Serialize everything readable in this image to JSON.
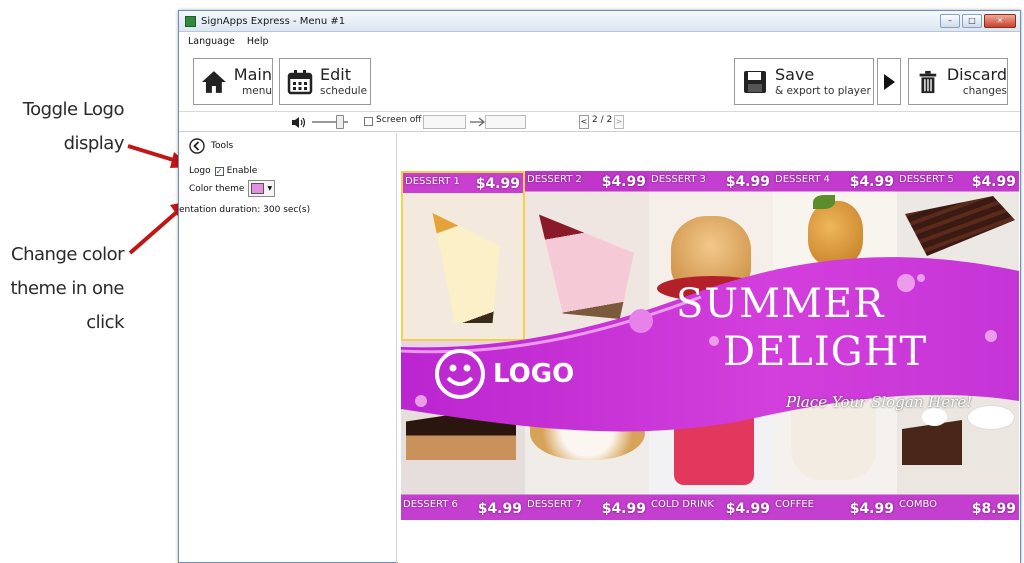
{
  "annotations": {
    "logo_line1": "Toggle Logo",
    "logo_line2": "display",
    "color_line1": "Change color",
    "color_line2": "theme in one",
    "color_line3": "click"
  },
  "window": {
    "title": "SignApps Express - Menu #1"
  },
  "menu": {
    "language": "Language",
    "help": "Help"
  },
  "toolbar": {
    "main_big": "Main",
    "main_small": "menu",
    "edit_big": "Edit",
    "edit_small": "schedule",
    "save_big": "Save",
    "save_small": "& export to player",
    "discard_big": "Discard",
    "discard_small": "changes"
  },
  "controls": {
    "screen_off": "Screen off",
    "page": "2 / 2"
  },
  "tools": {
    "title": "Tools",
    "logo_label": "Logo",
    "logo_enable": "Enable",
    "logo_checked": true,
    "color_theme_label": "Color theme",
    "color_theme_value": "#e58fe0",
    "duration": "entation duration: 300 sec(s)"
  },
  "preview": {
    "top_items": [
      {
        "name": "DESSERT 1",
        "price": "$4.99"
      },
      {
        "name": "DESSERT 2",
        "price": "$4.99"
      },
      {
        "name": "DESSERT 3",
        "price": "$4.99"
      },
      {
        "name": "DESSERT 4",
        "price": "$4.99"
      },
      {
        "name": "DESSERT 5",
        "price": "$4.99"
      }
    ],
    "bottom_items": [
      {
        "name": "DESSERT 6",
        "price": "$4.99"
      },
      {
        "name": "DESSERT 7",
        "price": "$4.99"
      },
      {
        "name": "COLD DRINK",
        "price": "$4.99"
      },
      {
        "name": "COFFEE",
        "price": "$4.99"
      },
      {
        "name": "COMBO",
        "price": "$8.99"
      }
    ],
    "title1": "SUMMER",
    "title2": "DELIGHT",
    "slogan": "Place Your Slogan Here!",
    "logo_text": "LOGO",
    "theme_color": "#c21ed6"
  }
}
